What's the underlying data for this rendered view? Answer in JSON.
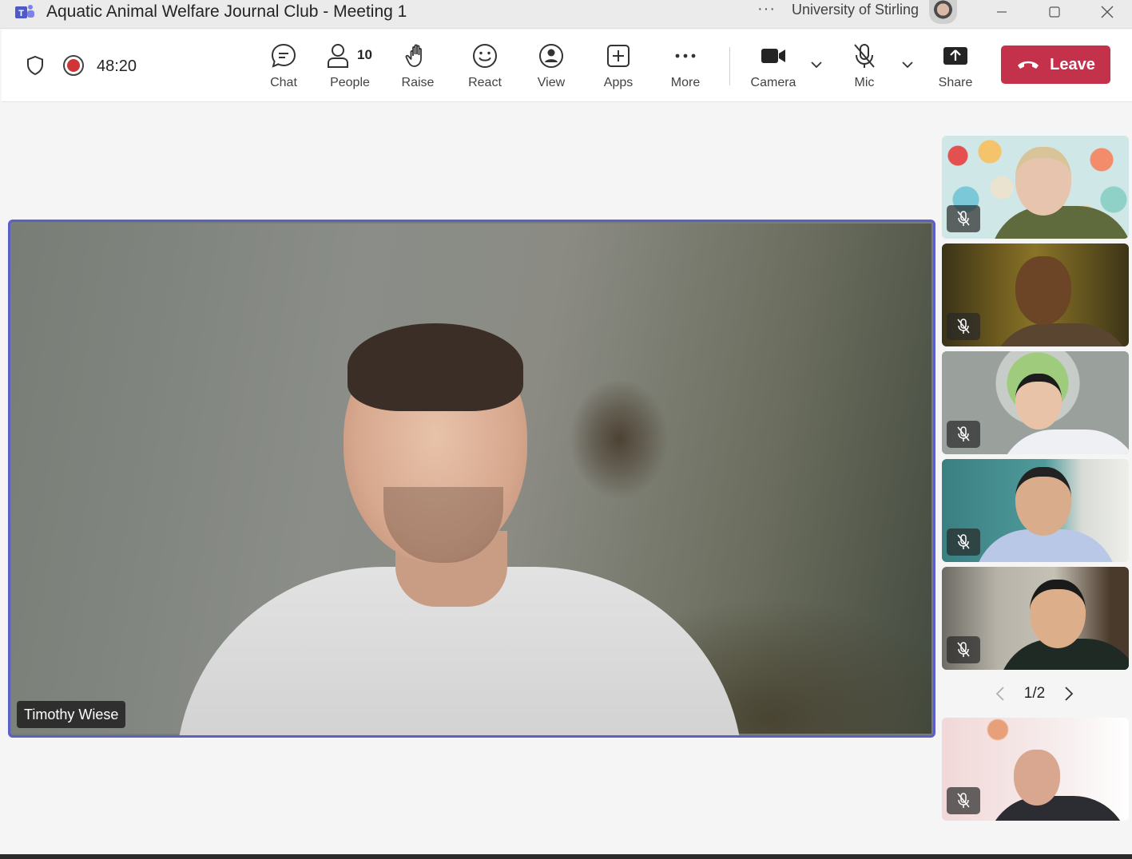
{
  "window": {
    "title": "Aquatic Animal Welfare Journal Club - Meeting 1",
    "organization": "University of Stirling",
    "more_dots": "···"
  },
  "toolbar": {
    "timer": "48:20",
    "buttons": {
      "chat": "Chat",
      "people": "People",
      "people_count": "10",
      "raise": "Raise",
      "react": "React",
      "view": "View",
      "apps": "Apps",
      "more": "More",
      "camera": "Camera",
      "mic": "Mic",
      "share": "Share",
      "leave": "Leave"
    },
    "leave_color": "#c4314b",
    "recording_color": "#d13438"
  },
  "stage": {
    "speaker_name": "Timothy Wiese",
    "highlight_color": "#5b5fc7"
  },
  "participants": {
    "thumbnails_muted": [
      true,
      true,
      true,
      true,
      true,
      true
    ],
    "pager": "1/2"
  },
  "icons": [
    "teams-icon",
    "shield-icon",
    "record-icon",
    "chat-icon",
    "people-icon",
    "raise-hand-icon",
    "react-icon",
    "view-icon",
    "apps-icon",
    "more-icon",
    "camera-icon",
    "mic-off-icon",
    "share-icon",
    "phone-hangup-icon",
    "chevron-left-icon",
    "chevron-right-icon"
  ]
}
